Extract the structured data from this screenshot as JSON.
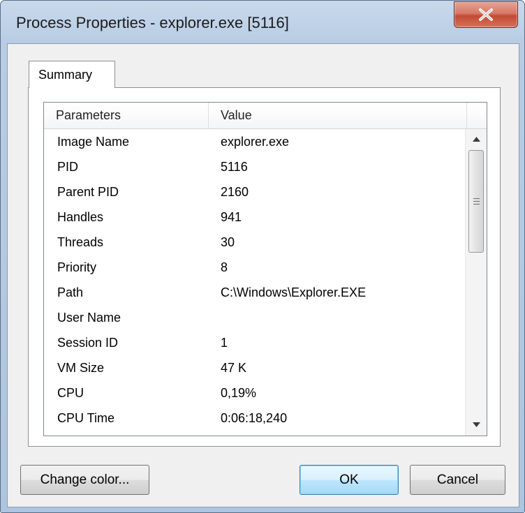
{
  "window": {
    "title": "Process Properties - explorer.exe [5116]"
  },
  "titlebar": {
    "close_icon": "close-x-icon",
    "close_color": "#c7503a"
  },
  "tabs": [
    {
      "label": "Summary",
      "selected": true
    }
  ],
  "listview": {
    "columns": [
      "Parameters",
      "Value"
    ],
    "rows": [
      {
        "param": "Image Name",
        "value": "explorer.exe"
      },
      {
        "param": "PID",
        "value": "5116"
      },
      {
        "param": "Parent PID",
        "value": "2160"
      },
      {
        "param": "Handles",
        "value": "941"
      },
      {
        "param": "Threads",
        "value": "30"
      },
      {
        "param": "Priority",
        "value": "8"
      },
      {
        "param": "Path",
        "value": "C:\\Windows\\Explorer.EXE"
      },
      {
        "param": "User Name",
        "value": ""
      },
      {
        "param": "Session ID",
        "value": "1"
      },
      {
        "param": "VM Size",
        "value": "47 K"
      },
      {
        "param": "CPU",
        "value": "0,19%"
      },
      {
        "param": "CPU Time",
        "value": "0:06:18,240"
      }
    ]
  },
  "scrollbar": {
    "up_icon": "scroll-up-arrow-icon",
    "down_icon": "scroll-down-arrow-icon"
  },
  "buttons": {
    "change_color": "Change color...",
    "ok": "OK",
    "cancel": "Cancel"
  }
}
